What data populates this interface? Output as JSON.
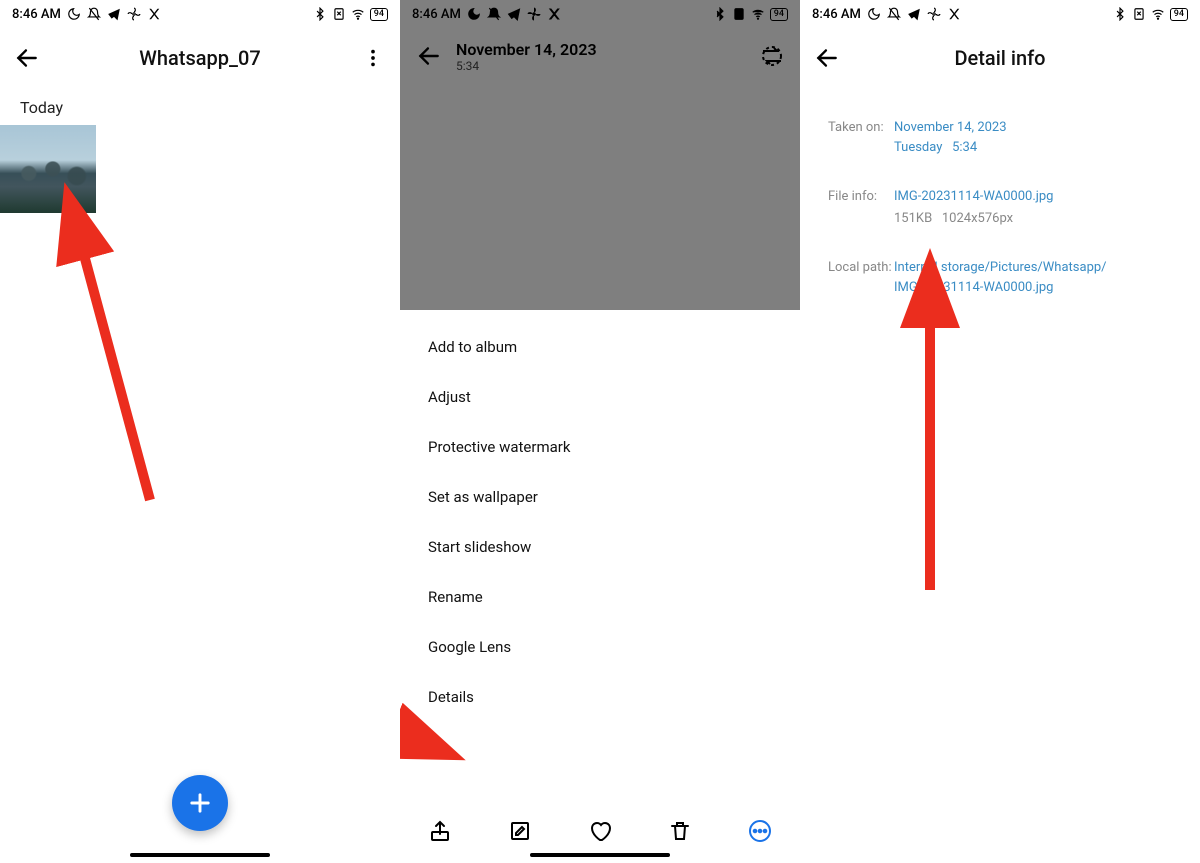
{
  "status": {
    "time": "8:46 AM",
    "battery": "94"
  },
  "screen1": {
    "title": "Whatsapp_07",
    "section": "Today"
  },
  "screen2": {
    "date": "November 14, 2023",
    "time": "5:34",
    "menu": {
      "add_to_album": "Add to album",
      "adjust": "Adjust",
      "protective_watermark": "Protective watermark",
      "set_as_wallpaper": "Set as wallpaper",
      "start_slideshow": "Start slideshow",
      "rename": "Rename",
      "google_lens": "Google Lens",
      "details": "Details"
    }
  },
  "screen3": {
    "title": "Detail info",
    "taken_on_label": "Taken on:",
    "taken_on_date": "November 14, 2023",
    "taken_on_day": "Tuesday",
    "taken_on_time": "5:34",
    "file_info_label": "File info:",
    "file_name": "IMG-20231114-WA0000.jpg",
    "file_size": "151KB",
    "file_dims": "1024x576px",
    "local_path_label": "Local path:",
    "local_path1": "Internal storage/Pictures/Whatsapp/",
    "local_path2": "IMG-20231114-WA0000.jpg"
  }
}
